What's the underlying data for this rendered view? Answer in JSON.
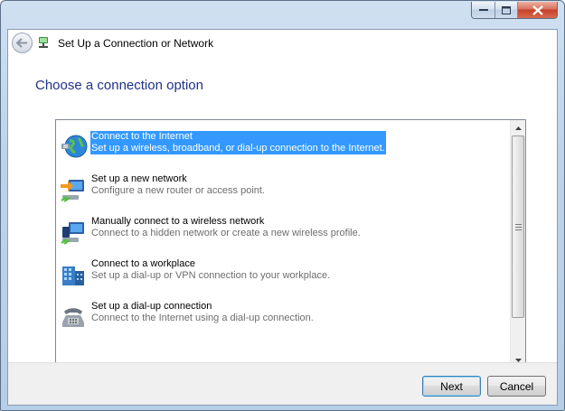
{
  "window": {
    "title": "Set Up a Connection or Network",
    "heading": "Choose a connection option"
  },
  "options": [
    {
      "title": "Connect to the Internet",
      "description": "Set up a wireless, broadband, or dial-up connection to the Internet.",
      "icon": "globe-icon",
      "selected": true
    },
    {
      "title": "Set up a new network",
      "description": "Configure a new router or access point.",
      "icon": "new-network-icon",
      "selected": false
    },
    {
      "title": "Manually connect to a wireless network",
      "description": "Connect to a hidden network or create a new wireless profile.",
      "icon": "wireless-network-icon",
      "selected": false
    },
    {
      "title": "Connect to a workplace",
      "description": "Set up a dial-up or VPN connection to your workplace.",
      "icon": "workplace-icon",
      "selected": false
    },
    {
      "title": "Set up a dial-up connection",
      "description": "Connect to the Internet using a dial-up connection.",
      "icon": "telephone-icon",
      "selected": false
    }
  ],
  "buttons": {
    "next": "Next",
    "cancel": "Cancel"
  },
  "colors": {
    "selection": "#3399ff",
    "heading": "#1e3287",
    "close_button": "#c6402a"
  }
}
